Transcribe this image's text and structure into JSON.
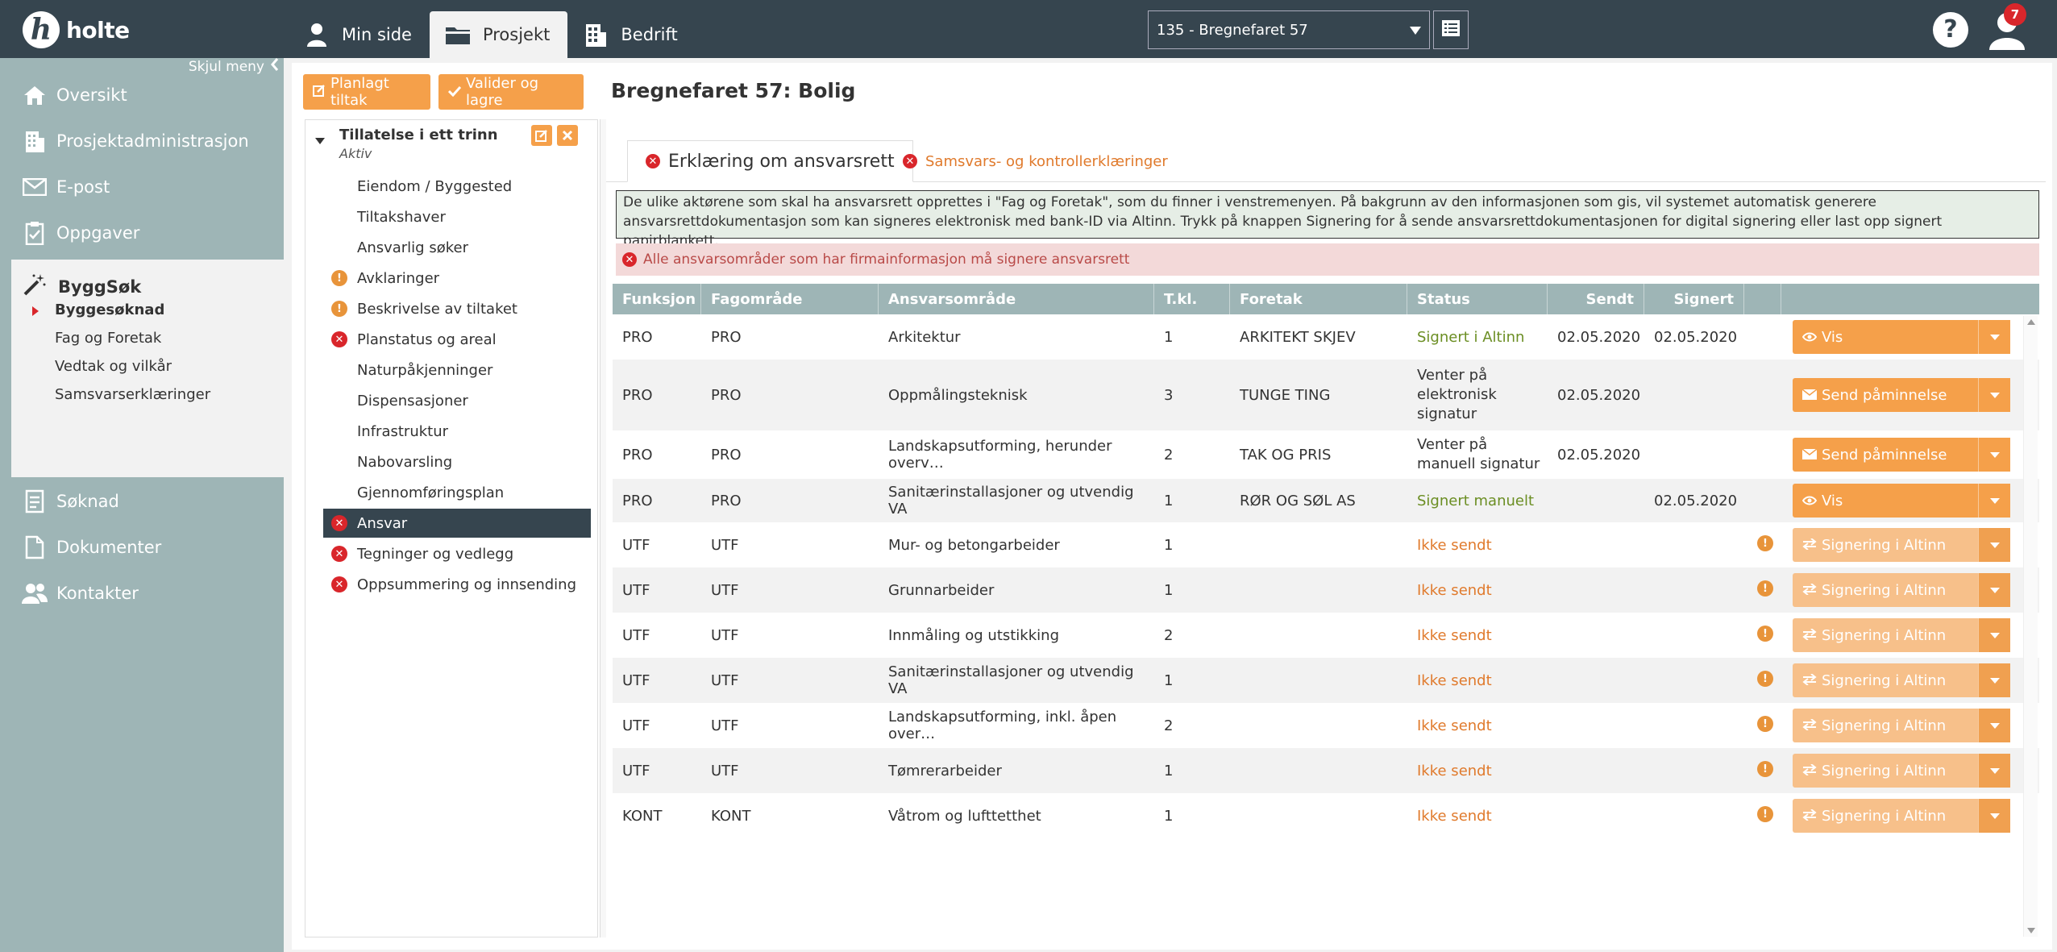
{
  "app": {
    "logo_letter": "h",
    "logo_text": "holte",
    "notification_count": "7",
    "help_label": "?"
  },
  "topnav": [
    {
      "label": "Min side",
      "icon": "person-icon"
    },
    {
      "label": "Prosjekt",
      "icon": "folder-icon"
    },
    {
      "label": "Bedrift",
      "icon": "building-icon"
    }
  ],
  "project_select": {
    "value": "135 - Bregnefaret 57"
  },
  "sidebar": {
    "hide_label": "Skjul meny",
    "items": [
      {
        "label": "Oversikt",
        "icon": "home-icon"
      },
      {
        "label": "Prosjektadministrasjon",
        "icon": "building-icon"
      },
      {
        "label": "E-post",
        "icon": "envelope-icon"
      },
      {
        "label": "Oppgaver",
        "icon": "clipboard-icon"
      },
      {
        "label": "Søknad",
        "icon": "document-list-icon"
      },
      {
        "label": "Dokumenter",
        "icon": "document-icon"
      },
      {
        "label": "Kontakter",
        "icon": "users-icon"
      }
    ],
    "byggsok": {
      "title": "ByggSøk",
      "icon": "magic-wand-icon",
      "subitems": [
        "Byggesøknad",
        "Fag og Foretak",
        "Vedtak og vilkår",
        "Samsvarserklæringer"
      ]
    }
  },
  "toolbar": {
    "planned_label": "Planlagt tiltak",
    "validate_label": "Valider og lagre"
  },
  "page_title": "Bregnefaret 57: Bolig",
  "tree": {
    "title": "Tillatelse i ett trinn",
    "status": "Aktiv",
    "items": [
      {
        "label": "Eiendom / Byggested",
        "mark": "none"
      },
      {
        "label": "Tiltakshaver",
        "mark": "none"
      },
      {
        "label": "Ansvarlig søker",
        "mark": "none"
      },
      {
        "label": "Avklaringer",
        "mark": "warn"
      },
      {
        "label": "Beskrivelse av tiltaket",
        "mark": "warn"
      },
      {
        "label": "Planstatus og areal",
        "mark": "err"
      },
      {
        "label": "Naturpåkjenninger",
        "mark": "none"
      },
      {
        "label": "Dispensasjoner",
        "mark": "none"
      },
      {
        "label": "Infrastruktur",
        "mark": "none"
      },
      {
        "label": "Nabovarsling",
        "mark": "none"
      },
      {
        "label": "Gjennomføringsplan",
        "mark": "none"
      },
      {
        "label": "Ansvar",
        "mark": "err"
      },
      {
        "label": "Tegninger og vedlegg",
        "mark": "err"
      },
      {
        "label": "Oppsummering og innsending",
        "mark": "err"
      }
    ]
  },
  "tabs": [
    {
      "label": "Erklæring om ansvarsrett"
    },
    {
      "label": "Samsvars- og kontrollerklæringer"
    }
  ],
  "info_text": "De ulike aktørene som skal ha ansvarsrett opprettes i \"Fag og Foretak\", som du finner i venstremenyen. På bakgrunn av den informasjonen som gis, vil systemet automatisk generere ansvarsrettdokumentasjon som kan signeres elektronisk med bank-ID via Altinn. Trykk på knappen Signering for å sende ansvarsrettdokumentasjonen for digital signering eller last opp signert papirblankett.",
  "alert_text": "Alle ansvarsområder som har firmainformasjon må signere ansvarsrett",
  "table": {
    "headers": [
      "Funksjon",
      "Fagområde",
      "Ansvarsområde",
      "T.kl.",
      "Foretak",
      "Status",
      "Sendt",
      "Signert"
    ],
    "rows": [
      {
        "funksjon": "PRO",
        "fagomrade": "PRO",
        "ansvarsomrade": "Arkitektur",
        "tkl": "1",
        "foretak": "ARKITEKT SKJEV",
        "status": "Signert i Altinn",
        "status_type": "ok",
        "sendt": "02.05.2020",
        "signert": "02.05.2020",
        "warn": false,
        "action": "Vis",
        "action_icon": "eye-icon",
        "disabled": false
      },
      {
        "funksjon": "PRO",
        "fagomrade": "PRO",
        "ansvarsomrade": "Oppmålingsteknisk",
        "tkl": "3",
        "foretak": "TUNGE TING",
        "status": "Venter på elektronisk signatur",
        "status_type": "neutral",
        "sendt": "02.05.2020",
        "signert": "",
        "warn": false,
        "action": "Send påminnelse",
        "action_icon": "envelope-icon",
        "disabled": false
      },
      {
        "funksjon": "PRO",
        "fagomrade": "PRO",
        "ansvarsomrade": "Landskapsutforming, herunder overv…",
        "tkl": "2",
        "foretak": "TAK OG PRIS",
        "status": "Venter på manuell signatur",
        "status_type": "neutral",
        "sendt": "02.05.2020",
        "signert": "",
        "warn": false,
        "action": "Send påminnelse",
        "action_icon": "envelope-icon",
        "disabled": false
      },
      {
        "funksjon": "PRO",
        "fagomrade": "PRO",
        "ansvarsomrade": "Sanitærinstallasjoner og utvendig VA",
        "tkl": "1",
        "foretak": "RØR OG SØL AS",
        "status": "Signert manuelt",
        "status_type": "ok",
        "sendt": "",
        "signert": "02.05.2020",
        "warn": false,
        "action": "Vis",
        "action_icon": "eye-icon",
        "disabled": false
      },
      {
        "funksjon": "UTF",
        "fagomrade": "UTF",
        "ansvarsomrade": "Mur- og betongarbeider",
        "tkl": "1",
        "foretak": "",
        "status": "Ikke sendt",
        "status_type": "notsent",
        "sendt": "",
        "signert": "",
        "warn": true,
        "action": "Signering i Altinn",
        "action_icon": "exchange-icon",
        "disabled": true
      },
      {
        "funksjon": "UTF",
        "fagomrade": "UTF",
        "ansvarsomrade": "Grunnarbeider",
        "tkl": "1",
        "foretak": "",
        "status": "Ikke sendt",
        "status_type": "notsent",
        "sendt": "",
        "signert": "",
        "warn": true,
        "action": "Signering i Altinn",
        "action_icon": "exchange-icon",
        "disabled": true
      },
      {
        "funksjon": "UTF",
        "fagomrade": "UTF",
        "ansvarsomrade": "Innmåling og utstikking",
        "tkl": "2",
        "foretak": "",
        "status": "Ikke sendt",
        "status_type": "notsent",
        "sendt": "",
        "signert": "",
        "warn": true,
        "action": "Signering i Altinn",
        "action_icon": "exchange-icon",
        "disabled": true
      },
      {
        "funksjon": "UTF",
        "fagomrade": "UTF",
        "ansvarsomrade": "Sanitærinstallasjoner og utvendig VA",
        "tkl": "1",
        "foretak": "",
        "status": "Ikke sendt",
        "status_type": "notsent",
        "sendt": "",
        "signert": "",
        "warn": true,
        "action": "Signering i Altinn",
        "action_icon": "exchange-icon",
        "disabled": true
      },
      {
        "funksjon": "UTF",
        "fagomrade": "UTF",
        "ansvarsomrade": "Landskapsutforming, inkl. åpen over…",
        "tkl": "2",
        "foretak": "",
        "status": "Ikke sendt",
        "status_type": "notsent",
        "sendt": "",
        "signert": "",
        "warn": true,
        "action": "Signering i Altinn",
        "action_icon": "exchange-icon",
        "disabled": true
      },
      {
        "funksjon": "UTF",
        "fagomrade": "UTF",
        "ansvarsomrade": "Tømrerarbeider",
        "tkl": "1",
        "foretak": "",
        "status": "Ikke sendt",
        "status_type": "notsent",
        "sendt": "",
        "signert": "",
        "warn": true,
        "action": "Signering i Altinn",
        "action_icon": "exchange-icon",
        "disabled": true
      },
      {
        "funksjon": "KONT",
        "fagomrade": "KONT",
        "ansvarsomrade": "Våtrom og lufttetthet",
        "tkl": "1",
        "foretak": "",
        "status": "Ikke sendt",
        "status_type": "notsent",
        "sendt": "",
        "signert": "",
        "warn": true,
        "action": "Signering i Altinn",
        "action_icon": "exchange-icon",
        "disabled": true
      }
    ]
  }
}
